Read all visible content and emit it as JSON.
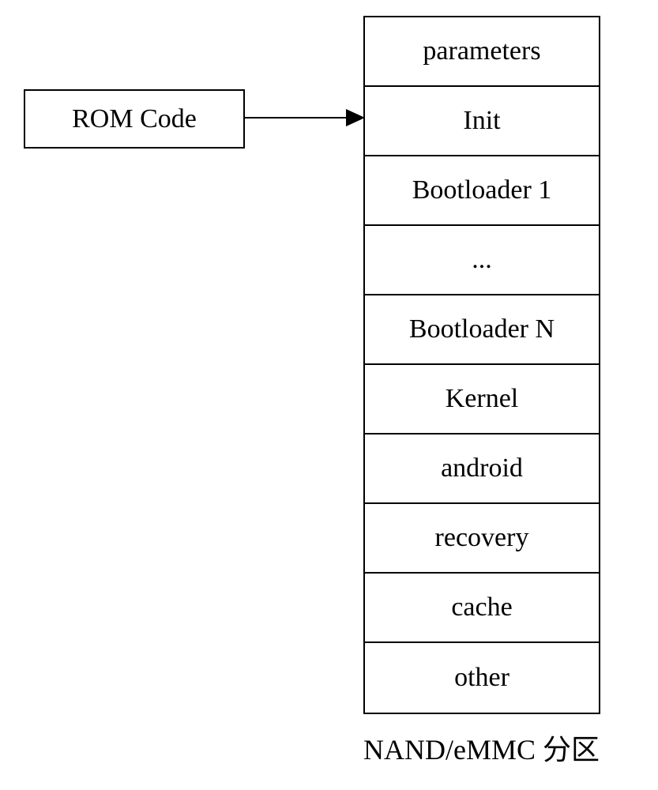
{
  "rom_label": "ROM Code",
  "partitions": [
    "parameters",
    "Init",
    "Bootloader 1",
    "...",
    "Bootloader N",
    "Kernel",
    "android",
    "recovery",
    "cache",
    "other"
  ],
  "caption": "NAND/eMMC 分区"
}
